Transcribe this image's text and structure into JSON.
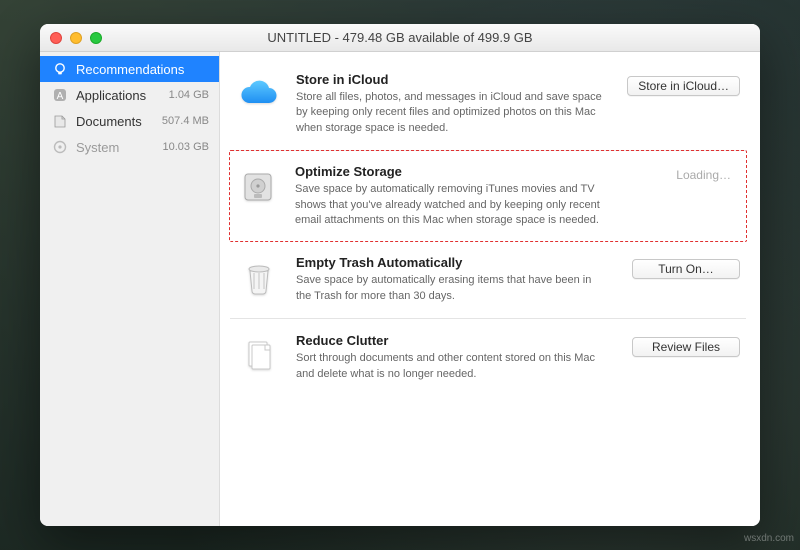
{
  "window": {
    "title": "UNTITLED - 479.48 GB available of 499.9 GB"
  },
  "sidebar": {
    "items": [
      {
        "label": "Recommendations",
        "size": ""
      },
      {
        "label": "Applications",
        "size": "1.04 GB"
      },
      {
        "label": "Documents",
        "size": "507.4 MB"
      },
      {
        "label": "System",
        "size": "10.03 GB"
      }
    ]
  },
  "recs": [
    {
      "title": "Store in iCloud",
      "desc": "Store all files, photos, and messages in iCloud and save space by keeping only recent files and optimized photos on this Mac when storage space is needed.",
      "action_label": "Store in iCloud…",
      "action_type": "button"
    },
    {
      "title": "Optimize Storage",
      "desc": "Save space by automatically removing iTunes movies and TV shows that you've already watched and by keeping only recent email attachments on this Mac when storage space is needed.",
      "action_label": "Loading…",
      "action_type": "loading"
    },
    {
      "title": "Empty Trash Automatically",
      "desc": "Save space by automatically erasing items that have been in the Trash for more than 30 days.",
      "action_label": "Turn On…",
      "action_type": "button"
    },
    {
      "title": "Reduce Clutter",
      "desc": "Sort through documents and other content stored on this Mac and delete what is no longer needed.",
      "action_label": "Review Files",
      "action_type": "button"
    }
  ],
  "watermark": "wsxdn.com"
}
